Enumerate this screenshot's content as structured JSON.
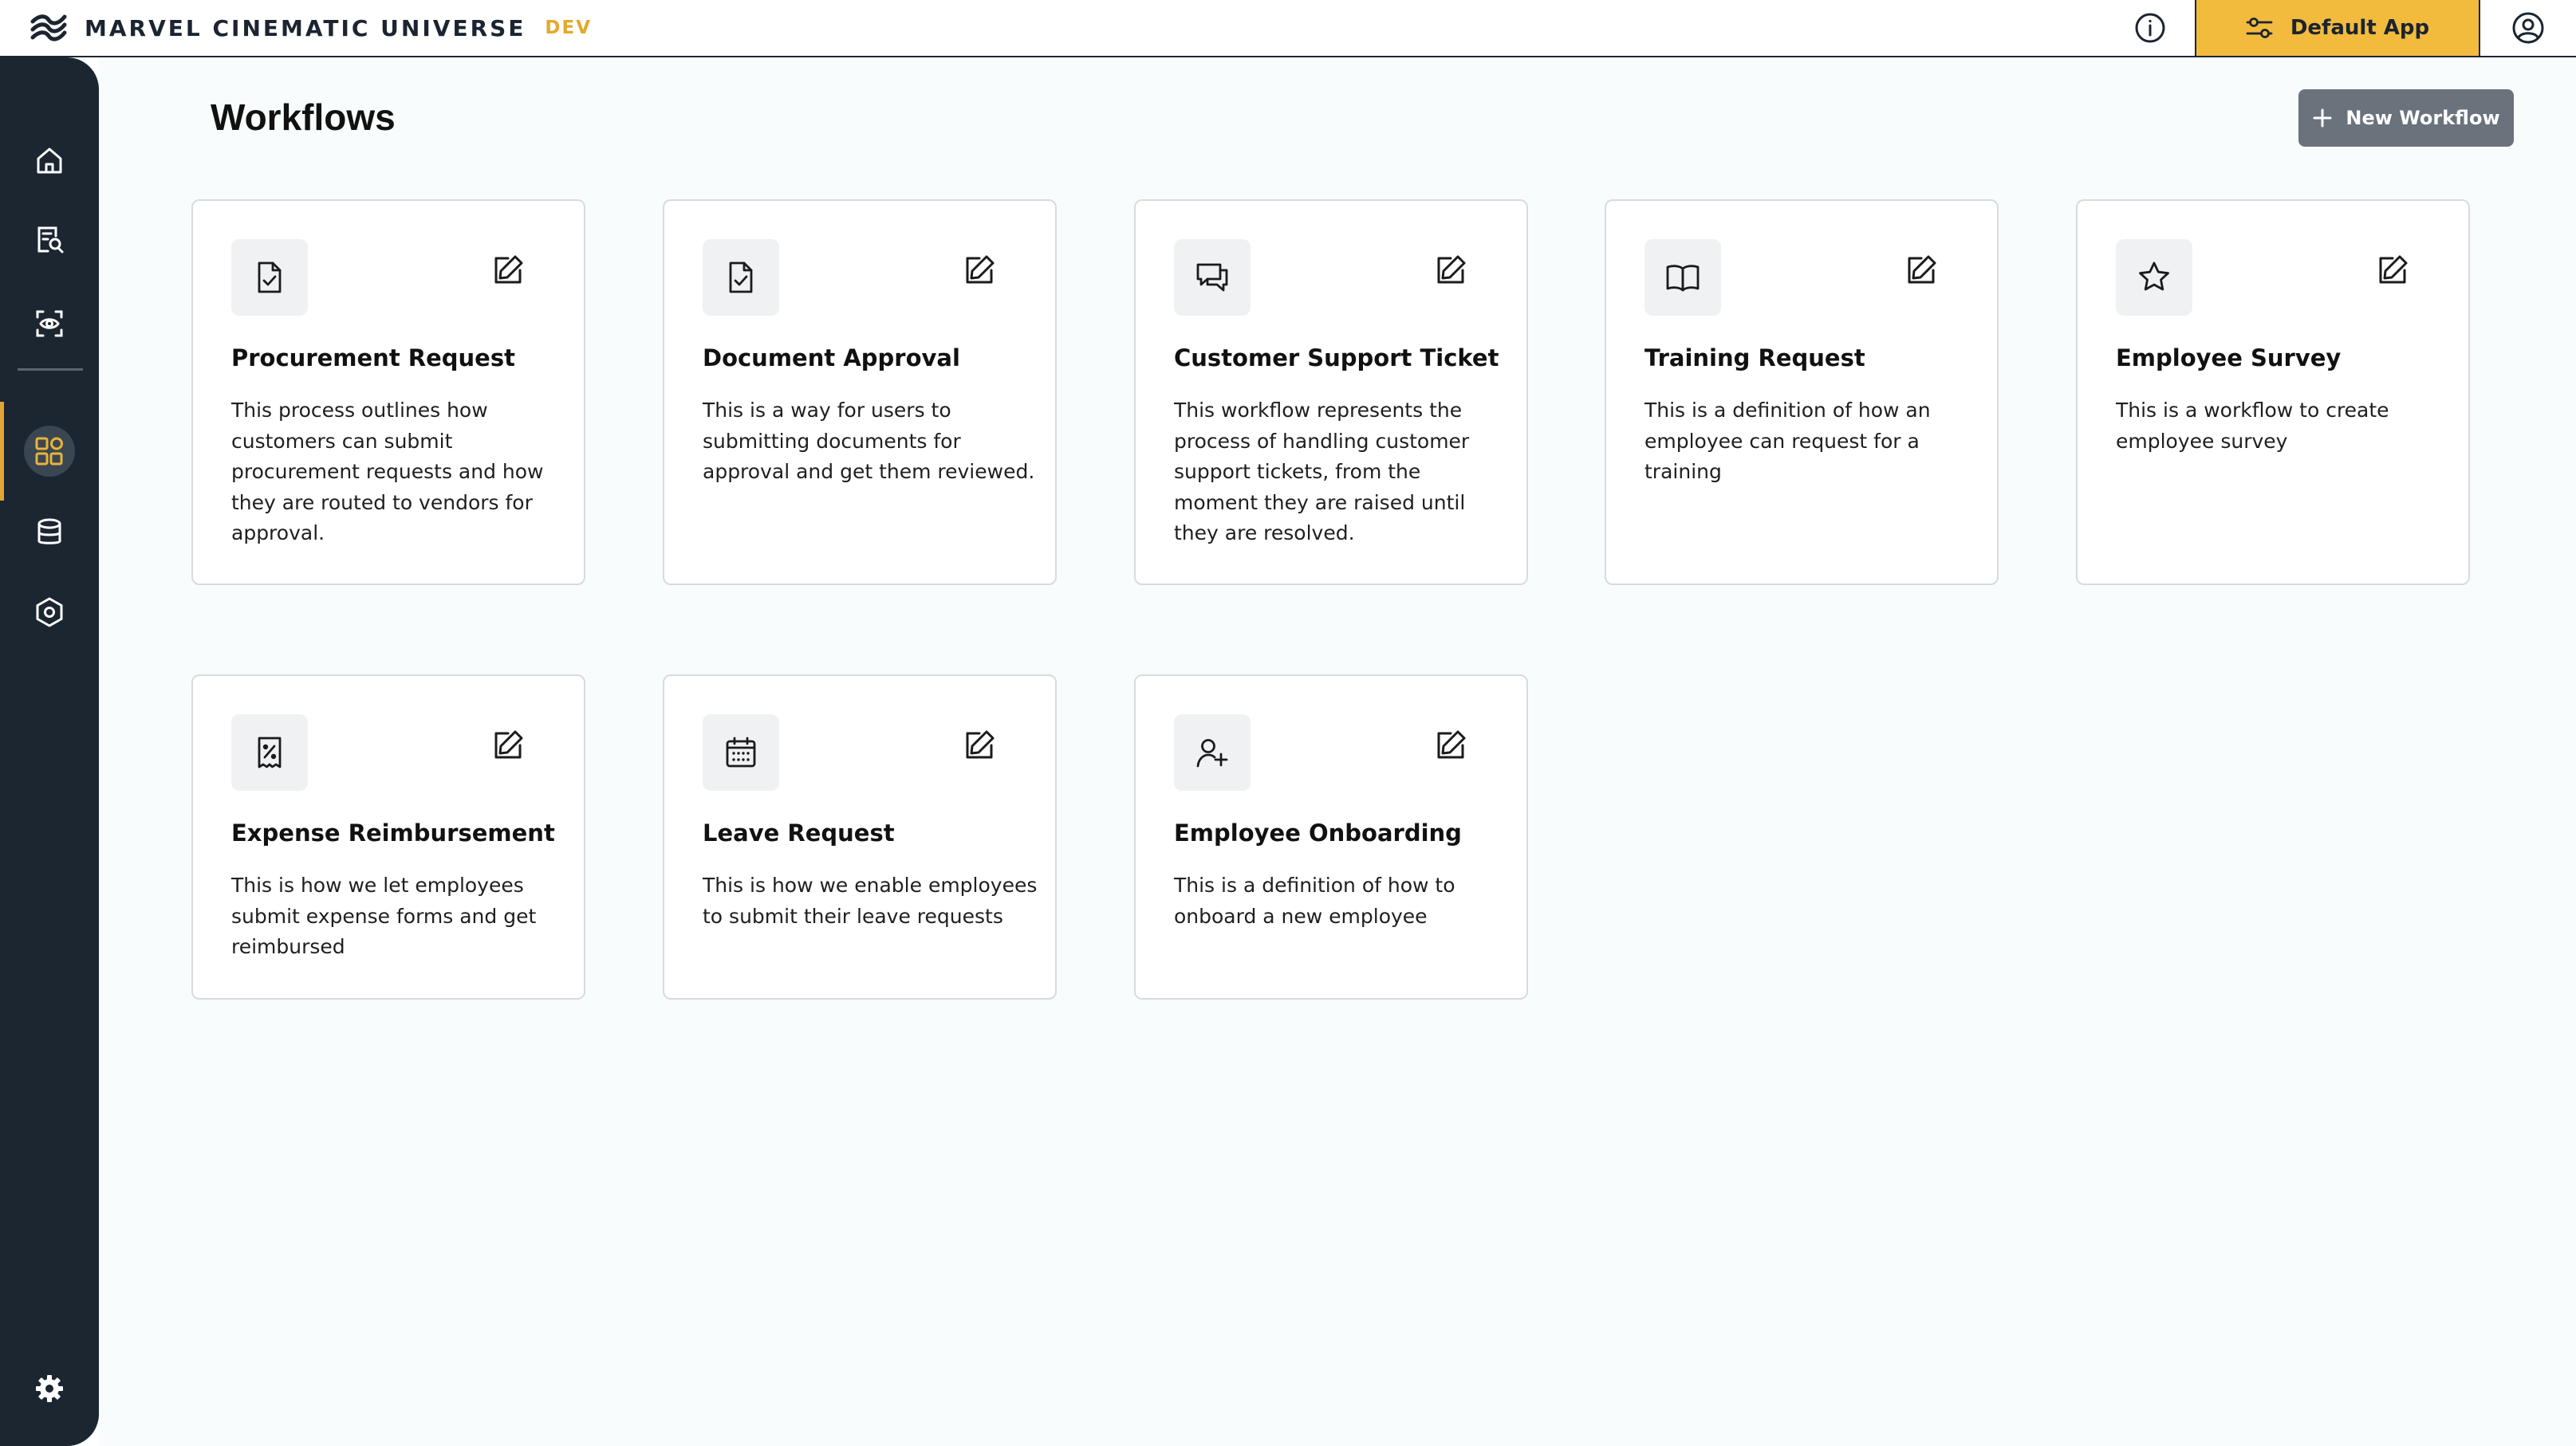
{
  "header": {
    "brand_name": "MARVEL CINEMATIC UNIVERSE",
    "env_badge": "DEV",
    "app_selector_label": "Default App",
    "accent_color": "#f2bb3e"
  },
  "sidebar": {
    "items": [
      {
        "icon": "home-icon"
      },
      {
        "icon": "document-search-icon"
      },
      {
        "icon": "scan-eye-icon"
      },
      {
        "icon": "workflows-icon",
        "active": true
      },
      {
        "icon": "database-icon"
      },
      {
        "icon": "hexagon-settings-icon"
      },
      {
        "icon": "gear-icon"
      }
    ]
  },
  "main": {
    "title": "Workflows",
    "new_button_label": "New Workflow",
    "cards": [
      {
        "icon": "file-check-icon",
        "title": "Procurement Request",
        "description": "This process outlines how customers can submit procurement requests and how they are routed to vendors for approval."
      },
      {
        "icon": "file-check-icon",
        "title": "Document Approval",
        "description": "This is a way for users to submitting documents for approval and get them reviewed."
      },
      {
        "icon": "chat-bubbles-icon",
        "title": "Customer Support Ticket",
        "description": "This workflow represents the process of handling customer support tickets, from the moment they are raised until they are resolved."
      },
      {
        "icon": "open-book-icon",
        "title": "Training Request",
        "description": "This is a definition of how an employee can request for a training"
      },
      {
        "icon": "star-icon",
        "title": "Employee Survey",
        "description": "This is a workflow to create employee survey"
      },
      {
        "icon": "receipt-percent-icon",
        "title": "Expense Reimbursement",
        "description": "This is how we let employees submit expense forms and get reimbursed"
      },
      {
        "icon": "calendar-icon",
        "title": "Leave Request",
        "description": "This is how we enable employees to submit their leave requests"
      },
      {
        "icon": "user-plus-icon",
        "title": "Employee Onboarding",
        "description": "This is a definition of how to onboard a new employee"
      }
    ]
  }
}
